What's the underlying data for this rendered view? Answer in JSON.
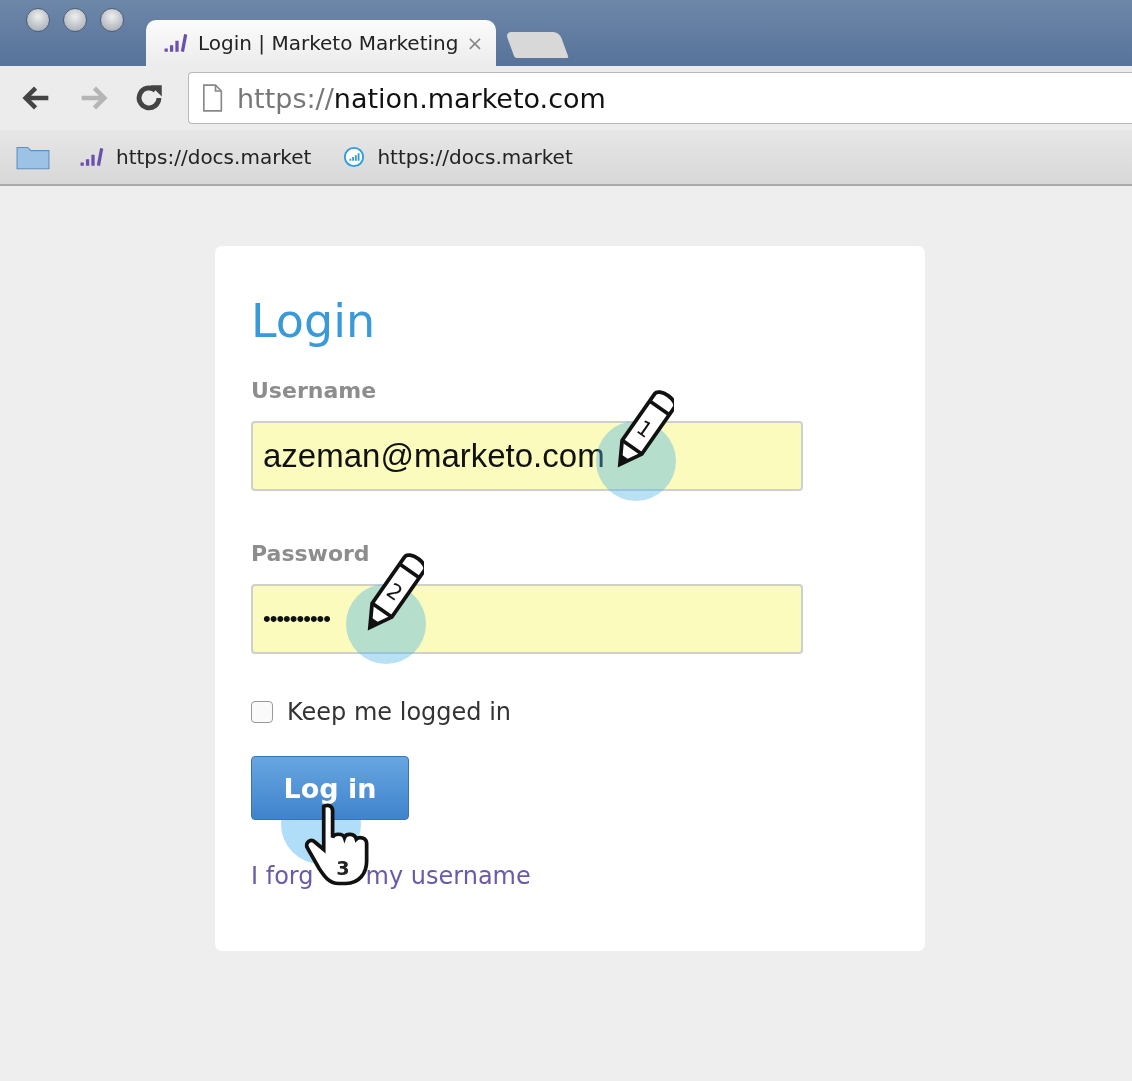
{
  "browser": {
    "tab": {
      "title": "Login | Marketo Marketing",
      "close": "×"
    },
    "address": {
      "scheme": "https://",
      "host": "nation.marketo.com"
    },
    "bookmarks": [
      {
        "kind": "bars",
        "label": "https://docs.market"
      },
      {
        "kind": "circle",
        "label": "https://docs.market"
      }
    ]
  },
  "login": {
    "title": "Login",
    "fields": [
      {
        "label": "Username",
        "value": "azeman@marketo.com",
        "step": "1",
        "kind": "pencil"
      },
      {
        "label": "Password",
        "value": "••••••••••",
        "step": "2",
        "kind": "pencil"
      }
    ],
    "remember": {
      "label": "Keep me logged in",
      "checked": false
    },
    "submit": {
      "label": "Log in",
      "step": "3",
      "kind": "hand"
    },
    "forgot_link": [
      "I forg",
      "my username"
    ]
  }
}
